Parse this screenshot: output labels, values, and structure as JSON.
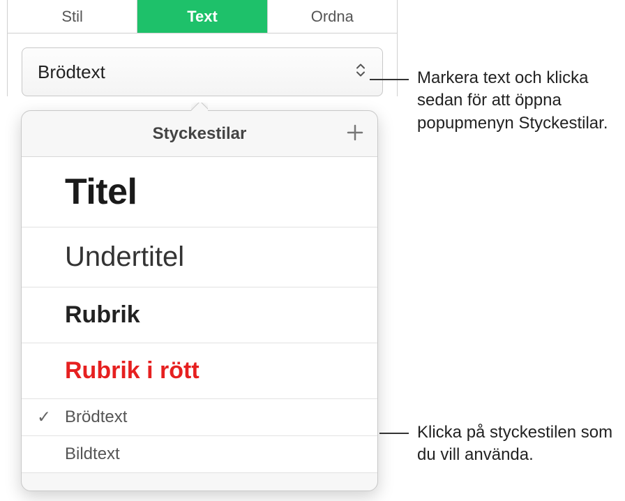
{
  "tabs": {
    "stil": "Stil",
    "text": "Text",
    "ordna": "Ordna"
  },
  "styleSelect": {
    "current": "Brödtext"
  },
  "popover": {
    "title": "Styckestilar",
    "addLabel": "+",
    "items": {
      "titel": "Titel",
      "undertitel": "Undertitel",
      "rubrik": "Rubrik",
      "rubrikRott": "Rubrik i rött",
      "brodtext": "Brödtext",
      "bildtext": "Bildtext"
    }
  },
  "callouts": {
    "c1": "Markera text och klicka sedan för att öppna popupmenyn Styckestilar.",
    "c2": "Klicka på styckestilen som du vill använda."
  }
}
